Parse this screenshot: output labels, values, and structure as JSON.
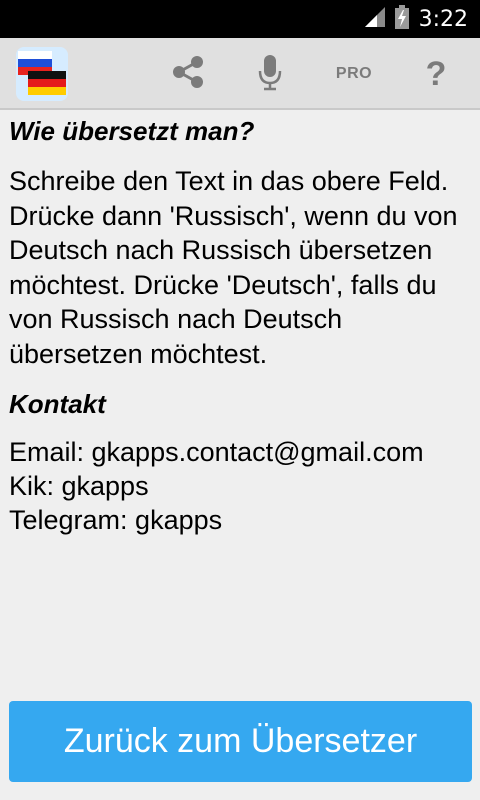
{
  "status_bar": {
    "time": "3:22",
    "icons": [
      "signal-icon",
      "battery-charging-icon"
    ]
  },
  "app_bar": {
    "app_icon": "flag-russia-germany-icon",
    "actions": {
      "share_icon": "share-icon",
      "mic_icon": "microphone-icon",
      "pro_label": "PRO",
      "help_label": "?"
    }
  },
  "content": {
    "how_heading": "Wie übersetzt man?",
    "how_text": "Schreibe den Text in das obere Feld. Drücke dann 'Russisch', wenn du von Deutsch nach Russisch übersetzen möchtest. Drücke 'Deutsch', falls du von Russisch nach Deutsch übersetzen möchtest.",
    "contact_heading": "Kontakt",
    "contact_email": "Email: gkapps.contact@gmail.com",
    "contact_kik": "Kik: gkapps",
    "contact_telegram": "Telegram: gkapps"
  },
  "footer": {
    "back_button_label": "Zurück zum Übersetzer"
  },
  "colors": {
    "status_bar": "#000000",
    "app_bar": "#e0e0e0",
    "background": "#efefef",
    "button": "#35a8f0",
    "icon_gray": "#7b7b7b"
  }
}
